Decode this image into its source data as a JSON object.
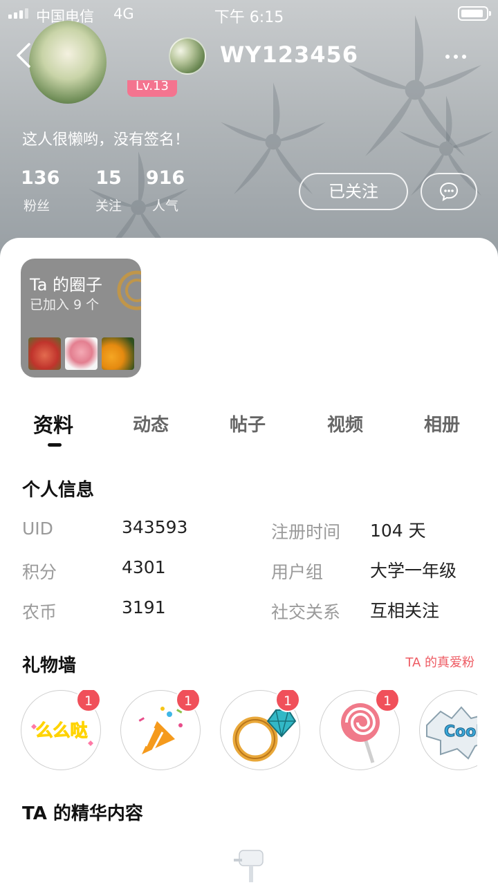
{
  "status_bar": {
    "carrier": "中国电信",
    "network": "4G",
    "time": "下午 6:15"
  },
  "nav": {
    "title": "WY123456",
    "back_icon": "chevron-left-icon",
    "more_icon": "more-icon"
  },
  "profile": {
    "level": "Lv.13",
    "signature": "这人很懒哟，没有签名！",
    "stats": [
      {
        "value": "136",
        "label": "粉丝"
      },
      {
        "value": "15",
        "label": "关注"
      },
      {
        "value": "916",
        "label": "人气"
      }
    ],
    "follow_label": "已关注",
    "chat_icon": "chat-icon"
  },
  "circles": {
    "title": "Ta 的圈子",
    "subtitle": "已加入 9 个"
  },
  "tabs": [
    {
      "label": "资料",
      "active": true
    },
    {
      "label": "动态",
      "active": false
    },
    {
      "label": "帖子",
      "active": false
    },
    {
      "label": "视频",
      "active": false
    },
    {
      "label": "相册",
      "active": false
    }
  ],
  "personal_info": {
    "title": "个人信息",
    "rows": [
      {
        "label": "UID",
        "value": "343593"
      },
      {
        "label": "积分",
        "value": "4301"
      },
      {
        "label": "农币",
        "value": "3191"
      },
      {
        "label": "注册时间",
        "value": "104 天"
      },
      {
        "label": "用户组",
        "value": "大学一年级"
      },
      {
        "label": "社交关系",
        "value": "互相关注"
      }
    ]
  },
  "gift_wall": {
    "title": "礼物墙",
    "link": "TA 的真爱粉",
    "gifts": [
      {
        "name": "memeda-sticker",
        "count": "1",
        "text": "么么哒"
      },
      {
        "name": "party-popper",
        "count": "1"
      },
      {
        "name": "diamond-ring",
        "count": "1"
      },
      {
        "name": "lollipop",
        "count": "1"
      },
      {
        "name": "cool-sticker",
        "count": "",
        "text": "Cool"
      }
    ]
  },
  "featured": {
    "title": "TA 的精华内容",
    "empty_icon": "mailbox-icon"
  },
  "colors": {
    "accent": "#f0505a",
    "link": "#ee5b63",
    "level_badge": "#f4748f"
  }
}
